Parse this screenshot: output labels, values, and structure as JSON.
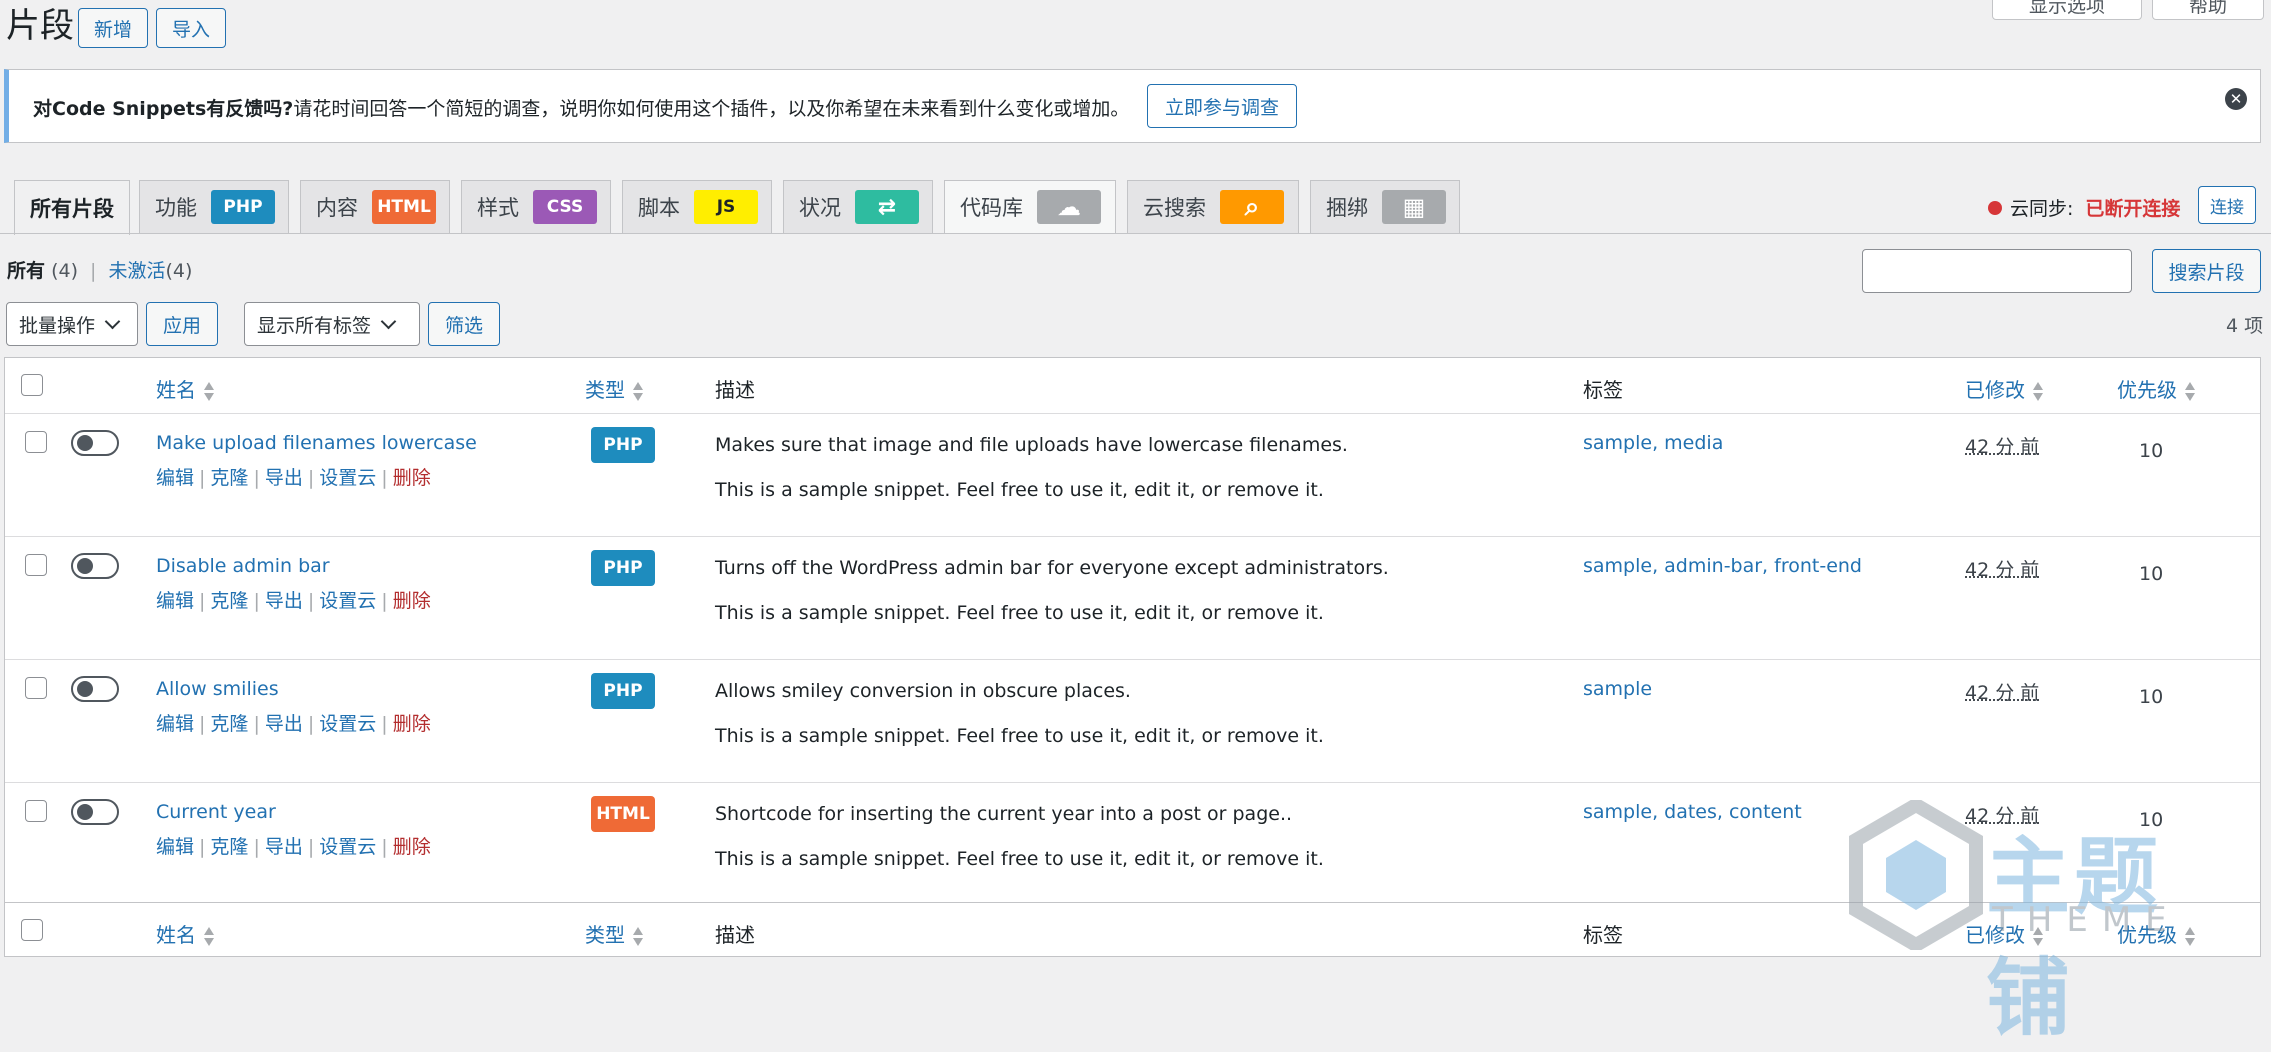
{
  "header": {
    "title": "片段",
    "add_new": "新增",
    "import": "导入",
    "screen_options": "显示选项",
    "help": "帮助"
  },
  "notice": {
    "bold": "对Code Snippets有反馈吗?",
    "text": "请花时间回答一个简短的调查，说明你如何使用这个插件，以及你希望在未来看到什么变化或增加。",
    "button": "立即参与调查",
    "close": "✕"
  },
  "tabs": [
    {
      "label": "所有片段",
      "badge": ""
    },
    {
      "label": "功能",
      "badge": "PHP",
      "color": "#1e8cbe"
    },
    {
      "label": "内容",
      "badge": "HTML",
      "color": "#ef6a36"
    },
    {
      "label": "样式",
      "badge": "CSS",
      "color": "#9b59b6"
    },
    {
      "label": "脚本",
      "badge": "JS",
      "color": "#ffee00"
    },
    {
      "label": "状况",
      "badge": "⇄",
      "color": "#2ebca0"
    },
    {
      "label": "代码库",
      "badge": "☁",
      "color": "#a7aaad"
    },
    {
      "label": "云搜索",
      "badge": "⌕",
      "color": "#ff9900"
    },
    {
      "label": "捆绑",
      "badge": "▦",
      "color": "#a7aaad"
    }
  ],
  "cloud_sync": {
    "label": "云同步:",
    "status": "已断开连接",
    "connect": "连接"
  },
  "views": {
    "all": "所有",
    "all_count": "(4)",
    "sep": "|",
    "inactive": "未激活",
    "inactive_count": "(4)"
  },
  "search": {
    "button": "搜索片段",
    "placeholder": ""
  },
  "bulk": {
    "select": "批量操作",
    "apply": "应用",
    "tags": "显示所有标签",
    "filter": "筛选",
    "count": "4 项"
  },
  "columns": {
    "name": "姓名",
    "type": "类型",
    "description": "描述",
    "tags": "标签",
    "modified": "已修改",
    "priority": "优先级"
  },
  "row_actions": {
    "edit": "编辑",
    "clone": "克隆",
    "export": "导出",
    "cloud": "设置云",
    "delete": "删除"
  },
  "snippets": [
    {
      "name": "Make upload filenames lowercase",
      "type": "PHP",
      "desc": "Makes sure that image and file uploads have lowercase filenames.",
      "note": "This is a sample snippet. Feel free to use it, edit it, or remove it.",
      "tags": "sample, media",
      "modified": "42 分 前",
      "priority": "10"
    },
    {
      "name": "Disable admin bar",
      "type": "PHP",
      "desc": "Turns off the WordPress admin bar for everyone except administrators.",
      "note": "This is a sample snippet. Feel free to use it, edit it, or remove it.",
      "tags": "sample, admin-bar, front-end",
      "modified": "42 分 前",
      "priority": "10"
    },
    {
      "name": "Allow smilies",
      "type": "PHP",
      "desc": "Allows smiley conversion in obscure places.",
      "note": "This is a sample snippet. Feel free to use it, edit it, or remove it.",
      "tags": "sample",
      "modified": "42 分 前",
      "priority": "10"
    },
    {
      "name": "Current year",
      "type": "HTML",
      "desc": "Shortcode for inserting the current year into a post or page..",
      "note": "This is a sample snippet. Feel free to use it, edit it, or remove it.",
      "tags": "sample, dates, content",
      "modified": "42 分 前",
      "priority": "10"
    }
  ],
  "watermark": {
    "main": "主题铺",
    "sub": "THEME"
  },
  "colors": {
    "accent": "#2271b1",
    "php": "#1e8cbe",
    "html": "#ef6a36",
    "danger": "#d63638"
  }
}
